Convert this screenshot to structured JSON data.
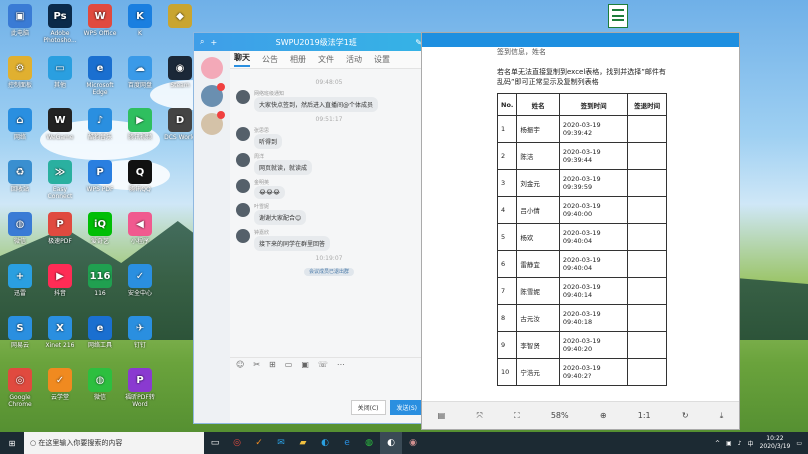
{
  "desktop_icons": [
    {
      "label": "此电脑",
      "color": "#3a7bd5",
      "glyph": "▣",
      "col": 0,
      "row": 0
    },
    {
      "label": "Adobe Photosho...",
      "color": "#0b2a4a",
      "glyph": "Ps",
      "col": 1,
      "row": 0
    },
    {
      "label": "WPS Office",
      "color": "#e04a3f",
      "glyph": "W",
      "col": 2,
      "row": 0
    },
    {
      "label": "K",
      "color": "#1a7fe0",
      "glyph": "K",
      "col": 3,
      "row": 0
    },
    {
      "label": "",
      "color": "#c9a530",
      "glyph": "◆",
      "col": 4,
      "row": 0
    },
    {
      "label": "控制面板",
      "color": "#e0b030",
      "glyph": "⚙",
      "col": 0,
      "row": 1
    },
    {
      "label": "其他",
      "color": "#2a9fe0",
      "glyph": "▭",
      "col": 1,
      "row": 1
    },
    {
      "label": "Microsoft Edge",
      "color": "#1a6fd0",
      "glyph": "e",
      "col": 2,
      "row": 1
    },
    {
      "label": "百度网盘",
      "color": "#3a9ae8",
      "glyph": "☁",
      "col": 3,
      "row": 1
    },
    {
      "label": "Steam",
      "color": "#1b2838",
      "glyph": "◉",
      "col": 4,
      "row": 1
    },
    {
      "label": "网络",
      "color": "#2a8fe0",
      "glyph": "⌂",
      "col": 0,
      "row": 2
    },
    {
      "label": "WeGame",
      "color": "#222222",
      "glyph": "W",
      "col": 1,
      "row": 2
    },
    {
      "label": "酷狗音乐",
      "color": "#2a8fe0",
      "glyph": "♪",
      "col": 2,
      "row": 2
    },
    {
      "label": "腾讯视频",
      "color": "#2fbf5f",
      "glyph": "▶",
      "col": 3,
      "row": 2
    },
    {
      "label": "DCS World",
      "color": "#444444",
      "glyph": "D",
      "col": 4,
      "row": 2
    },
    {
      "label": "回收站",
      "color": "#3a8fd0",
      "glyph": "♻",
      "col": 0,
      "row": 3
    },
    {
      "label": "Easy Connect",
      "color": "#2ab0a0",
      "glyph": "≫",
      "col": 1,
      "row": 3
    },
    {
      "label": "WPS PDF",
      "color": "#2a7fe0",
      "glyph": "P",
      "col": 2,
      "row": 3
    },
    {
      "label": "腾讯QQ",
      "color": "#111111",
      "glyph": "Q",
      "col": 3,
      "row": 3
    },
    {
      "label": "微信",
      "color": "#3a7bd5",
      "glyph": "◍",
      "col": 0,
      "row": 4
    },
    {
      "label": "极速PDF",
      "color": "#e04a3f",
      "glyph": "P",
      "col": 1,
      "row": 4
    },
    {
      "label": "爱奇艺",
      "color": "#00be06",
      "glyph": "iQ",
      "col": 2,
      "row": 4
    },
    {
      "label": "小程序",
      "color": "#f05a8f",
      "glyph": "◀",
      "col": 3,
      "row": 4
    },
    {
      "label": "迅雷",
      "color": "#2a9fe0",
      "glyph": "+",
      "col": 0,
      "row": 5
    },
    {
      "label": "抖音",
      "color": "#fe2c55",
      "glyph": "▶",
      "col": 1,
      "row": 5
    },
    {
      "label": "116",
      "color": "#20a050",
      "glyph": "116",
      "col": 2,
      "row": 5
    },
    {
      "label": "安全中心",
      "color": "#2a8fe0",
      "glyph": "✓",
      "col": 3,
      "row": 5
    },
    {
      "label": "网易云",
      "color": "#2a8fe0",
      "glyph": "S",
      "col": 0,
      "row": 6
    },
    {
      "label": "Xinet 216",
      "color": "#2a8fe0",
      "glyph": "X",
      "col": 1,
      "row": 6
    },
    {
      "label": "网络工具",
      "color": "#1a6fd0",
      "glyph": "e",
      "col": 2,
      "row": 6
    },
    {
      "label": "钉钉",
      "color": "#2a8fe0",
      "glyph": "✈",
      "col": 3,
      "row": 6
    },
    {
      "label": "Google Chrome",
      "color": "#e04a3f",
      "glyph": "◎",
      "col": 0,
      "row": 7
    },
    {
      "label": "云学堂",
      "color": "#f08a20",
      "glyph": "✓",
      "col": 1,
      "row": 7
    },
    {
      "label": "微信",
      "color": "#2dbf3f",
      "glyph": "◍",
      "col": 2,
      "row": 7
    },
    {
      "label": "福昕PDF转Word",
      "color": "#8a3ad0",
      "glyph": "P",
      "col": 3,
      "row": 7
    }
  ],
  "qq": {
    "title": "SWPU2019级法学1班",
    "tabs": [
      "聊天",
      "公告",
      "相册",
      "文件",
      "活动",
      "设置"
    ],
    "messages": [
      {
        "kind": "time",
        "text": "09:48:05"
      },
      {
        "kind": "msg",
        "name": "网络班级通知",
        "text": "大家快点签到，然后进入直播间@个体成员"
      },
      {
        "kind": "time",
        "text": "09:51:17"
      },
      {
        "kind": "msg",
        "name": "张思思",
        "text": "听得到"
      },
      {
        "kind": "msg",
        "name": "周洋",
        "text": "网页就读，就读成"
      },
      {
        "kind": "msg",
        "name": "金明英",
        "text": "😂😂😂"
      },
      {
        "kind": "msg",
        "name": "叶雪妮",
        "text": "谢谢大家配合😊"
      },
      {
        "kind": "msg",
        "name": "钟嘉欣",
        "text": "接下来的同学在群里回答"
      },
      {
        "kind": "time",
        "text": "10:19:07"
      },
      {
        "kind": "sys",
        "text": "会议成员已退出群"
      }
    ],
    "tools": [
      "☺",
      "✂",
      "⊞",
      "▭",
      "▣",
      "☏",
      "⋯"
    ],
    "buttons": {
      "close": "关闭(C)",
      "send": "发送(S)"
    }
  },
  "doc": {
    "partial_line": "签到信息，姓名",
    "intro": "若名单无法直接复制到excel表格，找到并选择”邮件有乱码”即可正常显示及复制列表格",
    "headers": [
      "No.",
      "姓名",
      "签到时间",
      "签退时间"
    ],
    "rows": [
      [
        "1",
        "杨振宇",
        "2020-03-19 09:39:42",
        ""
      ],
      [
        "2",
        "陈洁",
        "2020-03-19 09:39:44",
        ""
      ],
      [
        "3",
        "刘金元",
        "2020-03-19 09:39:59",
        ""
      ],
      [
        "4",
        "吕小倩",
        "2020-03-19 09:40:00",
        ""
      ],
      [
        "5",
        "杨欢",
        "2020-03-19 09:40:04",
        ""
      ],
      [
        "6",
        "雷静宜",
        "2020-03-19 09:40:04",
        ""
      ],
      [
        "7",
        "陈雪妮",
        "2020-03-19 09:40:14",
        ""
      ],
      [
        "8",
        "古元汝",
        "2020-03-19 09:40:18",
        ""
      ],
      [
        "9",
        "李智贤",
        "2020-03-19 09:40:20",
        ""
      ],
      [
        "10",
        "宁浩元",
        "2020-03-19 09:40:2?",
        ""
      ]
    ],
    "toolbar": {
      "zoom": "58%"
    }
  },
  "taskbar": {
    "search_placeholder": "在这里输入你要搜索的内容",
    "time": "10:22",
    "date": "2020/3/19",
    "ime": "中"
  }
}
